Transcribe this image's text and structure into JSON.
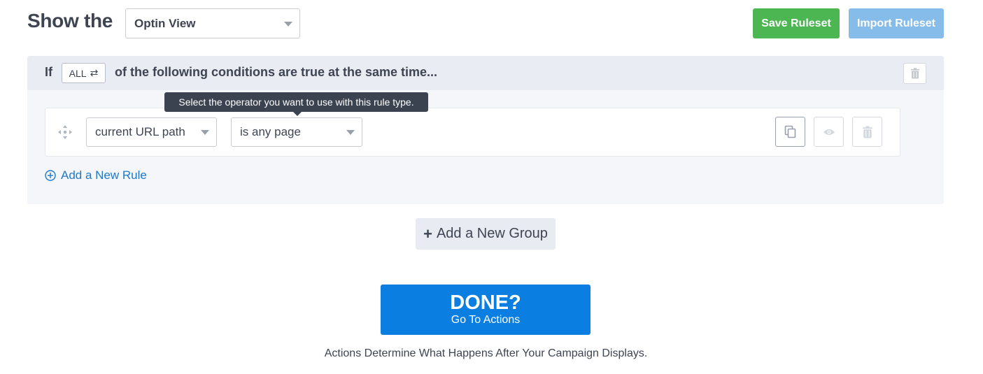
{
  "header": {
    "show_label": "Show the",
    "view_select_value": "Optin View",
    "save_label": "Save Ruleset",
    "import_label": "Import Ruleset"
  },
  "group": {
    "if_label": "If",
    "match_toggle": "ALL",
    "match_toggle_icon": "⇄",
    "condition_text": "of the following conditions are true at the same time..."
  },
  "rule": {
    "type_value": "current URL path",
    "operator_value": "is any page"
  },
  "tooltip": {
    "text": "Select the operator you want to use with this rule type."
  },
  "add_rule_label": "Add a New Rule",
  "add_group": {
    "plus": "+",
    "label": "Add a New Group"
  },
  "done": {
    "title": "DONE?",
    "subtitle": "Go To Actions"
  },
  "footer_text": "Actions Determine What Happens After Your Campaign Displays.",
  "colors": {
    "save_green": "#4cb652",
    "import_blue": "#86bce9",
    "done_blue": "#0b7fe1",
    "link_blue": "#1d78c9",
    "tooltip_bg": "#3b4250"
  }
}
